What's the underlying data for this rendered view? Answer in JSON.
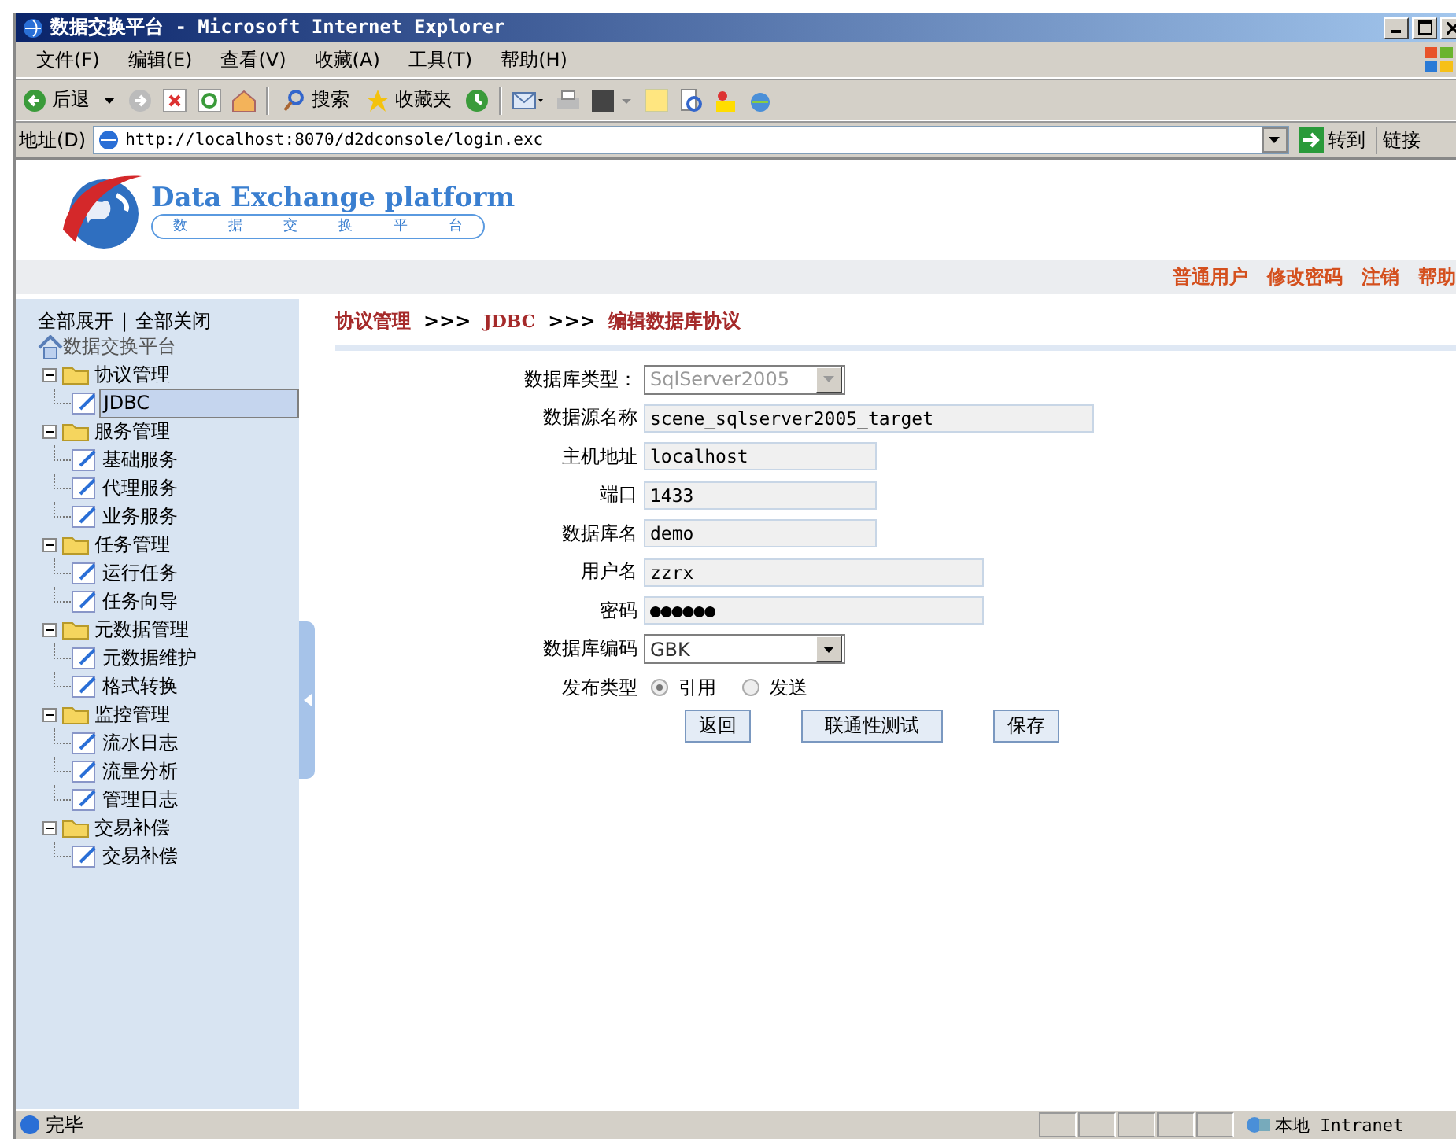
{
  "window": {
    "title": "数据交换平台 - Microsoft Internet Explorer"
  },
  "menu": [
    "文件(F)",
    "编辑(E)",
    "查看(V)",
    "收藏(A)",
    "工具(T)",
    "帮助(H)"
  ],
  "toolbar": {
    "back": "后退",
    "search": "搜索",
    "favorites": "收藏夹"
  },
  "address": {
    "label": "地址(D)",
    "url": "http://localhost:8070/d2dconsole/login.exc",
    "go": "转到",
    "links": "链接"
  },
  "banner": {
    "title": "Data Exchange platform",
    "subtitle": [
      "数",
      "据",
      "交",
      "换",
      "平",
      "台"
    ]
  },
  "user_links": [
    "普通用户",
    "修改密码",
    "注销",
    "帮助"
  ],
  "sidebar": {
    "expand_all": "全部展开",
    "separator": "|",
    "collapse_all": "全部关闭",
    "tree": {
      "label": "数据交换平台",
      "children": [
        {
          "label": "协议管理",
          "expanded": true,
          "children": [
            {
              "label": "JDBC",
              "selected": true
            }
          ]
        },
        {
          "label": "服务管理",
          "expanded": true,
          "children": [
            {
              "label": "基础服务",
              "selected": false
            },
            {
              "label": "代理服务",
              "selected": false
            },
            {
              "label": "业务服务",
              "selected": false
            }
          ]
        },
        {
          "label": "任务管理",
          "expanded": true,
          "children": [
            {
              "label": "运行任务",
              "selected": false
            },
            {
              "label": "任务向导",
              "selected": false
            }
          ]
        },
        {
          "label": "元数据管理",
          "expanded": true,
          "children": [
            {
              "label": "元数据维护",
              "selected": false
            },
            {
              "label": "格式转换",
              "selected": false
            }
          ]
        },
        {
          "label": "监控管理",
          "expanded": true,
          "children": [
            {
              "label": "流水日志",
              "selected": false
            },
            {
              "label": "流量分析",
              "selected": false
            },
            {
              "label": "管理日志",
              "selected": false
            }
          ]
        },
        {
          "label": "交易补偿",
          "expanded": true,
          "children": [
            {
              "label": "交易补偿",
              "selected": false
            }
          ]
        }
      ]
    }
  },
  "breadcrumb": [
    "协议管理",
    "JDBC",
    "编辑数据库协议"
  ],
  "breadcrumb_separator": ">>>",
  "form": [
    {
      "kind": "select",
      "label": "数据库类型：",
      "value": "SqlServer2005",
      "disabled": true
    },
    {
      "kind": "text",
      "label": "数据源名称",
      "value": "scene_sqlserver2005_target"
    },
    {
      "kind": "text",
      "label": "主机地址",
      "value": "localhost"
    },
    {
      "kind": "text",
      "label": "端口",
      "value": "1433"
    },
    {
      "kind": "text",
      "label": "数据库名",
      "value": "demo"
    },
    {
      "kind": "text",
      "label": "用户名",
      "value": "zzrx"
    },
    {
      "kind": "text",
      "label": "密码",
      "value": "●●●●●●"
    },
    {
      "kind": "select",
      "label": "数据库编码",
      "value": "GBK",
      "disabled": false
    },
    {
      "kind": "radio",
      "label": "发布类型",
      "options": [
        {
          "label": "引用",
          "selected": true
        },
        {
          "label": "发送",
          "selected": false
        }
      ]
    }
  ],
  "buttons": [
    "返回",
    "联通性测试",
    "保存"
  ],
  "status_bar": {
    "text": "完毕",
    "zone": "本地 Intranet"
  }
}
